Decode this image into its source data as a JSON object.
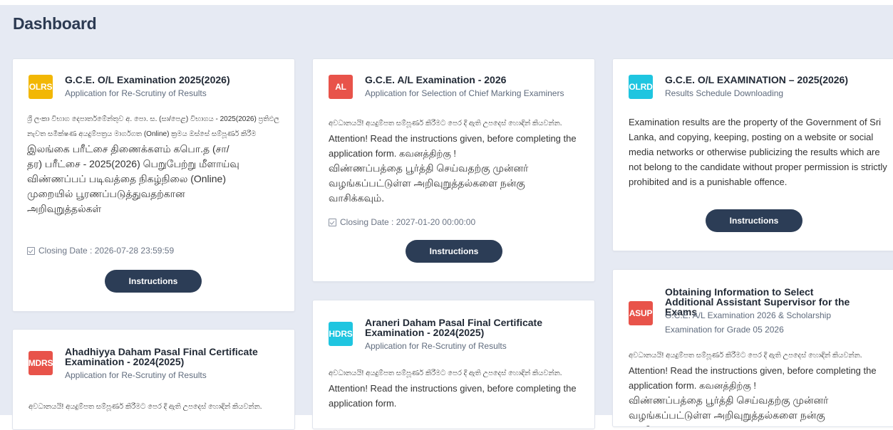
{
  "page": {
    "title": "Dashboard"
  },
  "colors": {
    "background": "#e6eaf3",
    "button": "#2c3d56",
    "badge_yellow": "#f2b705",
    "badge_red": "#e8534a",
    "badge_cyan": "#1fc5e0"
  },
  "cards": [
    {
      "badge": "OLRS",
      "title": "G.C.E. O/L Examination 2025(2026)",
      "subtitle": "Application for Re-Scrutiny of Results",
      "body_si": "ශ්‍රී ලංකා විභාග දෙපාර්තමේන්තුව අ. පො. ස. (සා/පෙළ) විභාගය - 2025(2026) ප්‍රතිඵල නැවත සමීක්ෂණ අයදුම්පත්‍රය මාර්ගගත (Online) ක්‍රමය ඔස්සේ සම්පූර්ණ කිරීම",
      "body_ta": "இலங்கை பரீட்சை திணைக்களம் கபொ.த (சா/தர) பரீட்சை - 2025(2026) பெறுபேற்று மீளாய்வு விண்ணப்பப் படிவத்தை நிகழ்நிலை (Online) முறையில் பூரணப்படுத்துவதற்கான அறிவுறுத்தல்கள்",
      "closing": "Closing Date : 2026-07-28 23:59:59",
      "button": "Instructions"
    },
    {
      "badge": "AL",
      "title": "G.C.E. A/L Examination - 2026",
      "subtitle": "Application for Selection of Chief Marking Examiners",
      "body_si": "අවධානයයි! අයදුම්පත සම්පූර්ණ කිරීමට පෙර දී ඇති උපදෙස් හොඳින් කියවන්න.",
      "body_en": " Attention! Read the instructions given, before completing the application form. கவனத்திற்கு !",
      "body_ta": "விண்ணப்பத்தை பூர்த்தி செய்வதற்கு முன்னர் வழங்கப்பட்டுள்ள அறிவுறுத்தல்களை நன்கு வாசிக்கவும்.",
      "closing": "Closing Date : 2027-01-20 00:00:00",
      "button": "Instructions"
    },
    {
      "badge": "OLRD",
      "title": "G.C.E. O/L EXAMINATION – 2025(2026)",
      "subtitle": "Results Schedule Downloading",
      "body_en": "Examination results are the property of the Government of Sri Lanka, and copying, keeping, posting on a website or social media networks or otherwise publicizing the results which are not belong to the candidate without proper permission is strictly prohibited and is a punishable offence.",
      "button": "Instructions"
    },
    {
      "badge": "MDRS",
      "title": "Ahadhiyya Daham Pasal Final Certificate Examination - 2024(2025)",
      "subtitle": "Application for Re-Scrutiny of Results",
      "body_si": "අවධානයයි! අයදුම්පත සම්පූර්ණ කිරීමට පෙර දී ඇති උපදෙස් හොඳින් කියවන්න."
    },
    {
      "badge": "HDRS",
      "title": "Araneri Daham Pasal Final Certificate Examination - 2024(2025)",
      "subtitle": "Application for Re-Scrutiny of Results",
      "body_si": "අවධානයයි! අයදුම්පත සම්පූර්ණ කිරීමට පෙර දී ඇති උපදෙස් හොඳින් කියවන්න.",
      "body_en": "Attention! Read the instructions given, before completing the application form."
    },
    {
      "badge": "ASUP",
      "title": "Obtaining Information to Select Additional Assistant Supervisor for the Exams",
      "subtitle": "G.C.E. A/L Examination 2026 & Scholarship Examination for Grade 05 2026",
      "body_si": "අවධානයයි! අයදුම්පත සම්පූර්ණ කිරීමට පෙර දී ඇති උපදෙස් හොඳින් කියවන්න.",
      "body_en": " Attention! Read the instructions given, before completing the application form. கவனத்திற்கு !",
      "body_ta": "விண்ணப்பத்தை பூர்த்தி செய்வதற்கு முன்னர் வழங்கப்பட்டுள்ள அறிவுறுத்தல்களை நன்கு வாசிக்கவும்."
    }
  ]
}
